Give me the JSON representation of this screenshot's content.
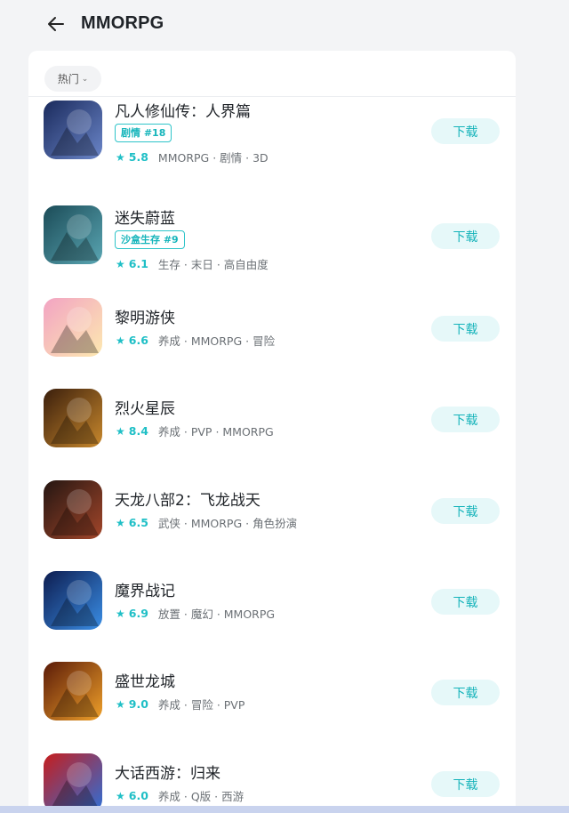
{
  "header": {
    "title": "MMORPG",
    "back_icon": "arrow-left-icon"
  },
  "filter": {
    "label": "热门",
    "icon": "chevron-down-icon"
  },
  "accent_color": "#1fbfc6",
  "apps": [
    {
      "name": "凡人修仙传：人界篇",
      "tag": "剧情 #18",
      "score": "5.8",
      "meta": "MMORPG · 剧情 · 3D",
      "button": "下载",
      "icon_colors": [
        "#1a2a5c",
        "#6b86c9"
      ]
    },
    {
      "name": "迷失蔚蓝",
      "tag": "沙盒生存 #9",
      "score": "6.1",
      "meta": "生存 · 末日 · 高自由度",
      "button": "下载",
      "icon_colors": [
        "#1b4b57",
        "#5aa6b3"
      ]
    },
    {
      "name": "黎明游侠",
      "tag": "",
      "score": "6.6",
      "meta": "养成 · MMORPG · 冒险",
      "button": "下载",
      "icon_colors": [
        "#f2a3c3",
        "#fde9b0"
      ]
    },
    {
      "name": "烈火星辰",
      "tag": "",
      "score": "8.4",
      "meta": "养成 · PVP · MMORPG",
      "button": "下载",
      "icon_colors": [
        "#3a1e0c",
        "#c9892d"
      ]
    },
    {
      "name": "天龙八部2：飞龙战天",
      "tag": "",
      "score": "6.5",
      "meta": "武侠 · MMORPG · 角色扮演",
      "button": "下载",
      "icon_colors": [
        "#241612",
        "#a3462a"
      ]
    },
    {
      "name": "魔界战记",
      "tag": "",
      "score": "6.9",
      "meta": "放置 · 魔幻 · MMORPG",
      "button": "下载",
      "icon_colors": [
        "#0d1c4f",
        "#3a8ee6"
      ]
    },
    {
      "name": "盛世龙城",
      "tag": "",
      "score": "9.0",
      "meta": "养成 · 冒险 · PVP",
      "button": "下载",
      "icon_colors": [
        "#5a1a08",
        "#f0a12a"
      ]
    },
    {
      "name": "大话西游：归来",
      "tag": "",
      "score": "6.0",
      "meta": "养成 · Q版 · 西游",
      "button": "下载",
      "icon_colors": [
        "#c61d1d",
        "#2f6fd6"
      ]
    }
  ]
}
